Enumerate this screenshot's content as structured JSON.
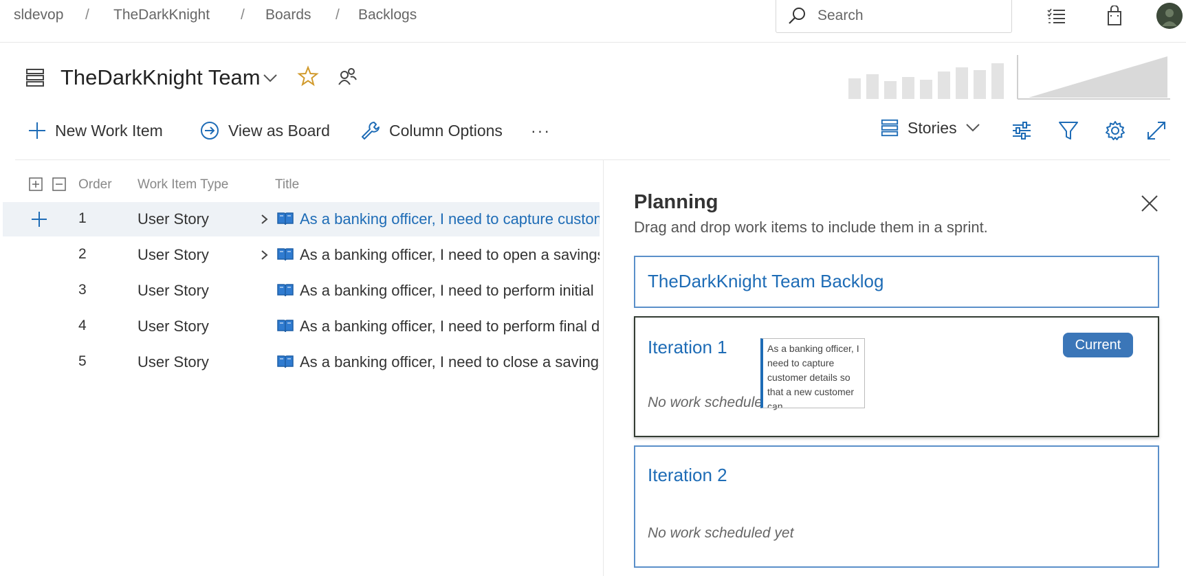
{
  "breadcrumb": {
    "items": [
      "sldevop",
      "TheDarkKnight",
      "Boards",
      "Backlogs"
    ],
    "separator": "/"
  },
  "search": {
    "placeholder": "Search"
  },
  "header": {
    "team_name": "TheDarkKnight Team"
  },
  "toolbar": {
    "new_work_item": "New Work Item",
    "view_as_board": "View as Board",
    "column_options": "Column Options",
    "more": "···",
    "stories": "Stories"
  },
  "grid": {
    "columns": [
      "Order",
      "Work Item Type",
      "Title"
    ],
    "rows": [
      {
        "order": "1",
        "type": "User Story",
        "title": "As a banking officer, I need to capture customer details so that a new customer can",
        "expandable": true,
        "selected": true
      },
      {
        "order": "2",
        "type": "User Story",
        "title": "As a banking officer, I need to open a savings account",
        "expandable": true,
        "selected": false
      },
      {
        "order": "3",
        "type": "User Story",
        "title": "As a banking officer, I need to perform initial",
        "expandable": false,
        "selected": false
      },
      {
        "order": "4",
        "type": "User Story",
        "title": "As a banking officer, I need to perform final deposit",
        "expandable": false,
        "selected": false
      },
      {
        "order": "5",
        "type": "User Story",
        "title": "As a banking officer, I need to close a savings account",
        "expandable": false,
        "selected": false
      }
    ]
  },
  "planning": {
    "title": "Planning",
    "subtitle": "Drag and drop work items to include them in a sprint.",
    "backlog_card": "TheDarkKnight Team Backlog",
    "iterations": [
      {
        "name": "Iteration 1",
        "empty_text": "No work scheduled yet",
        "badge": "Current"
      },
      {
        "name": "Iteration 2",
        "empty_text": "No work scheduled yet",
        "badge": ""
      }
    ],
    "drag_preview": "As a banking officer, I need to capture customer details so that a new customer can"
  },
  "colors": {
    "accent": "#1e6cb6",
    "badge": "#3b76b8",
    "card_border": "#5a8fc9",
    "selected_row": "#eef2f6"
  },
  "icons": [
    "search-icon",
    "list-icon",
    "shopping-bag-icon",
    "team-backlog-icon",
    "chevron-down-icon",
    "star-icon",
    "people-icon",
    "plus-icon",
    "arrow-circle-icon",
    "wrench-icon",
    "filter-settings-icon",
    "funnel-icon",
    "gear-icon",
    "expand-icon",
    "close-icon",
    "book-icon"
  ]
}
